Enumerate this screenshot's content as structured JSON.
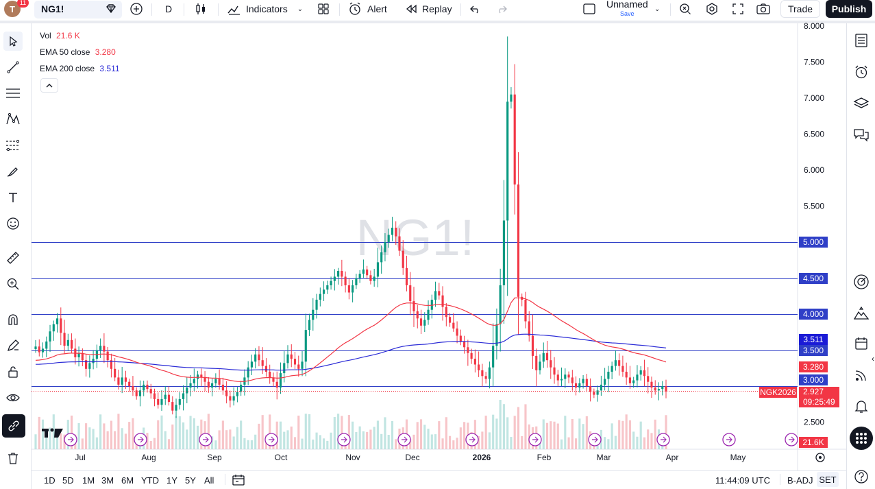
{
  "header": {
    "avatar_letter": "T",
    "notification_count": "11",
    "symbol": "NG1!",
    "interval": "D",
    "indicators_label": "Indicators",
    "alert_label": "Alert",
    "replay_label": "Replay",
    "layout_name": "Unnamed",
    "save_label": "Save",
    "trade_label": "Trade",
    "publish_label": "Publish"
  },
  "legend": {
    "vol_label": "Vol",
    "vol_value": "21.6 K",
    "ema50_label": "EMA 50 close",
    "ema50_value": "3.280",
    "ema200_label": "EMA 200 close",
    "ema200_value": "3.511"
  },
  "colors": {
    "up": "#089981",
    "down": "#f23645",
    "ema50": "#f23645",
    "ema200": "#2b2bd6",
    "hline": "#2f3fc7",
    "vol_up": "#b2dfdb",
    "vol_down": "#f5b7bb"
  },
  "watermark": "NG1!",
  "price_axis": {
    "ticks": [
      "8.000",
      "7.500",
      "7.000",
      "6.500",
      "6.000",
      "5.500",
      "2.500"
    ],
    "hline_labels": [
      "5.000",
      "4.500",
      "4.000",
      "3.500",
      "3.000"
    ],
    "ema200_label": "3.511",
    "ema50_label": "3.280",
    "last_price": "2.927",
    "countdown": "09:25:49",
    "contract_label": "NGK2026",
    "volume_label": "21.6K"
  },
  "time_axis": [
    "Jul",
    "Aug",
    "Sep",
    "Oct",
    "Nov",
    "Dec",
    "2026",
    "Feb",
    "Mar",
    "Apr",
    "May"
  ],
  "bottom": {
    "ranges": [
      "1D",
      "5D",
      "1M",
      "3M",
      "6M",
      "YTD",
      "1Y",
      "5Y",
      "All"
    ],
    "time": "11:44:09 UTC",
    "badj": "B-ADJ",
    "set": "SET"
  },
  "chart_data": {
    "type": "candlestick",
    "symbol": "NG1!",
    "interval": "1D",
    "ylim": [
      2.2,
      8.1
    ],
    "horizontal_lines": [
      5.0,
      4.5,
      4.0,
      3.5,
      3.0
    ],
    "last_price": 2.927,
    "ema50_last": 3.28,
    "ema200_last": 3.511,
    "volume_last": "21.6K",
    "x_labels": [
      "Jul",
      "Aug",
      "Sep",
      "Oct",
      "Nov",
      "Dec",
      "2026",
      "Feb",
      "Mar",
      "Apr",
      "May"
    ],
    "closes": [
      3.55,
      3.47,
      3.52,
      3.62,
      3.76,
      3.86,
      3.94,
      3.74,
      3.56,
      3.64,
      3.52,
      3.4,
      3.46,
      3.36,
      3.24,
      3.32,
      3.38,
      3.5,
      3.56,
      3.48,
      3.36,
      3.24,
      3.12,
      3.02,
      3.12,
      3.06,
      3.0,
      2.94,
      2.86,
      2.94,
      3.02,
      2.96,
      2.9,
      2.82,
      2.74,
      2.82,
      2.88,
      2.78,
      2.66,
      2.74,
      2.82,
      2.9,
      2.98,
      3.04,
      3.1,
      3.16,
      3.12,
      3.06,
      2.98,
      3.04,
      3.1,
      3.02,
      2.94,
      2.86,
      2.8,
      2.86,
      2.92,
      3.02,
      3.12,
      3.26,
      3.34,
      3.44,
      3.36,
      3.28,
      3.2,
      3.12,
      3.06,
      2.98,
      3.18,
      3.32,
      3.44,
      3.38,
      3.3,
      3.24,
      3.34,
      3.78,
      3.92,
      4.06,
      4.2,
      4.28,
      4.34,
      4.4,
      4.46,
      4.52,
      4.6,
      4.52,
      4.4,
      4.3,
      4.4,
      4.5,
      4.56,
      4.62,
      4.54,
      4.46,
      4.52,
      4.72,
      4.86,
      5.0,
      5.1,
      5.2,
      5.08,
      4.88,
      4.64,
      4.4,
      4.18,
      4.04,
      3.94,
      3.84,
      3.92,
      4.06,
      4.2,
      4.32,
      4.26,
      4.1,
      3.96,
      3.88,
      3.8,
      3.7,
      3.62,
      3.54,
      3.46,
      3.38,
      3.3,
      3.22,
      3.14,
      3.1,
      3.26,
      3.56,
      3.86,
      4.4,
      5.3,
      6.95,
      7.05,
      5.8,
      4.24,
      4.2,
      3.9,
      3.7,
      3.42,
      3.22,
      3.34,
      3.46,
      3.36,
      3.26,
      3.16,
      3.08,
      3.1,
      3.16,
      3.12,
      3.04,
      2.98,
      3.04,
      3.1,
      3.0,
      2.92,
      2.88,
      2.94,
      3.02,
      3.1,
      3.2,
      3.28,
      3.36,
      3.28,
      3.2,
      3.12,
      3.04,
      3.08,
      3.16,
      3.22,
      3.14,
      3.06,
      2.98,
      2.94,
      2.96,
      3.0,
      2.927
    ]
  }
}
